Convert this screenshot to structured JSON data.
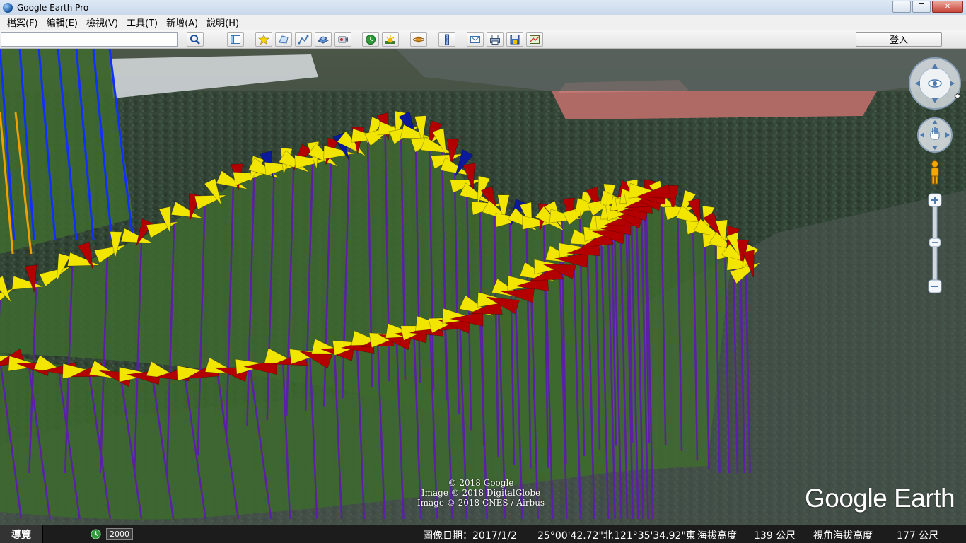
{
  "window": {
    "title": "Google Earth Pro",
    "minimize": "─",
    "maximize": "❐",
    "close": "✕"
  },
  "menu": [
    "檔案(F)",
    "編輯(E)",
    "檢視(V)",
    "工具(T)",
    "新增(A)",
    "說明(H)"
  ],
  "toolbar": {
    "search_value": "",
    "search_icon": "search-icon",
    "buttons": [
      "sidebar-icon",
      "placemark-icon",
      "polygon-icon",
      "path-icon",
      "overlay-icon",
      "record-tour-icon",
      "historical-imagery-icon",
      "sunlight-icon",
      "planets-icon",
      "ruler-icon",
      "email-icon",
      "print-icon",
      "save-image-icon",
      "maps-icon"
    ],
    "login_label": "登入"
  },
  "attribution": [
    "© 2018 Google",
    "Image © 2018 DigitalGlobe",
    "Image © 2018 CNES / Airbus"
  ],
  "logo": "Google Earth",
  "status": {
    "nav_label": "導覽",
    "year": "2000",
    "imagery_date": "圖像日期：2017/1/2",
    "lat": "25°00'42.72\"北",
    "lon": "121°35'34.92\"東",
    "elev_label": "海拔高度",
    "elev_value": "139 公尺",
    "eye_label": "視角海拔高度",
    "eye_value": "177 公尺"
  },
  "colors": {
    "curtain": "#3f6b2f",
    "curtain_lines": "#5b1fa8",
    "arrow_yellow": "#f2e600",
    "arrow_red": "#b30000",
    "arrow_blue": "#0a1a9a",
    "left_lines_blue": "#1030ff",
    "left_lines_orange": "#f0a000"
  }
}
